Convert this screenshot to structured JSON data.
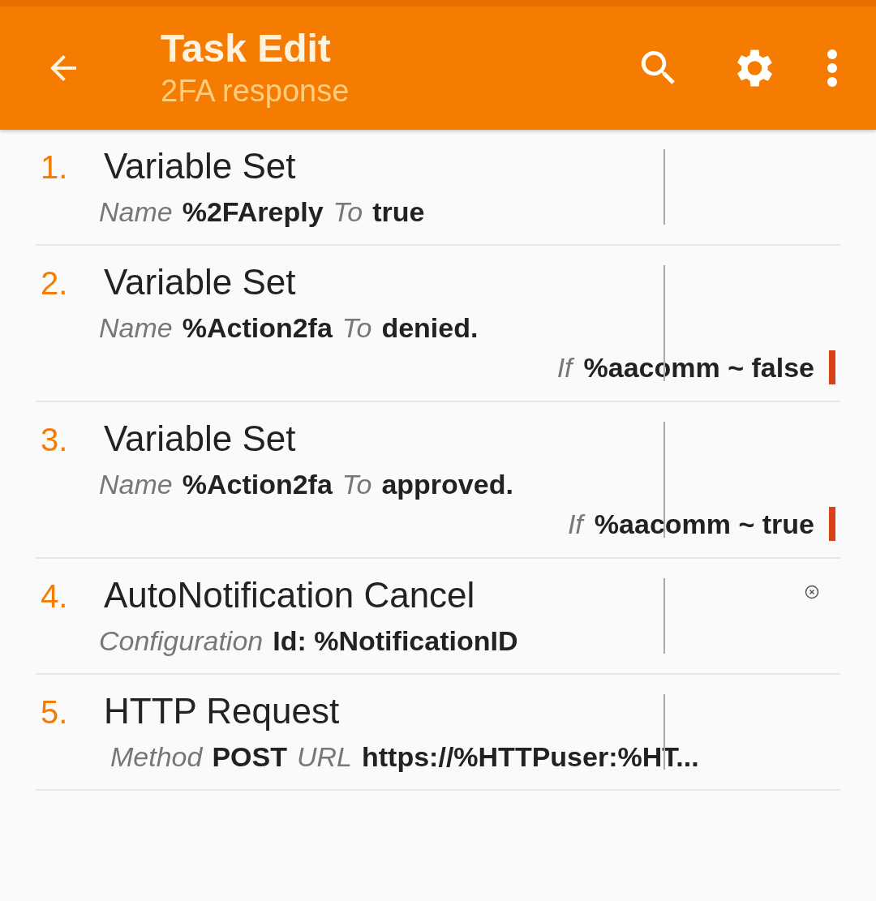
{
  "app_bar": {
    "title": "Task Edit",
    "subtitle": "2FA response"
  },
  "actions": [
    {
      "number": "1.",
      "title": "Variable Set",
      "params": [
        {
          "label": "Name",
          "value": "%2FAreply"
        },
        {
          "label": "To",
          "value": "true"
        }
      ],
      "flagged": false
    },
    {
      "number": "2.",
      "title": "Variable Set",
      "params": [
        {
          "label": "Name",
          "value": "%Action2fa"
        },
        {
          "label": "To",
          "value": "denied."
        }
      ],
      "condition": {
        "label": "If",
        "value": "%aacomm ~ false"
      },
      "flagged": false
    },
    {
      "number": "3.",
      "title": "Variable Set",
      "params": [
        {
          "label": "Name",
          "value": "%Action2fa"
        },
        {
          "label": "To",
          "value": "approved."
        }
      ],
      "condition": {
        "label": "If",
        "value": "%aacomm ~ true"
      },
      "flagged": false
    },
    {
      "number": "4.",
      "title": "AutoNotification Cancel",
      "params": [
        {
          "label": "Configuration",
          "value": "Id: %NotificationID"
        }
      ],
      "flagged": true
    },
    {
      "number": "5.",
      "title": "HTTP Request",
      "params": [
        {
          "label": "Method",
          "value": "POST"
        },
        {
          "label": "URL",
          "value": "https://%HTTPuser:%HT..."
        }
      ],
      "flagged": false
    }
  ]
}
